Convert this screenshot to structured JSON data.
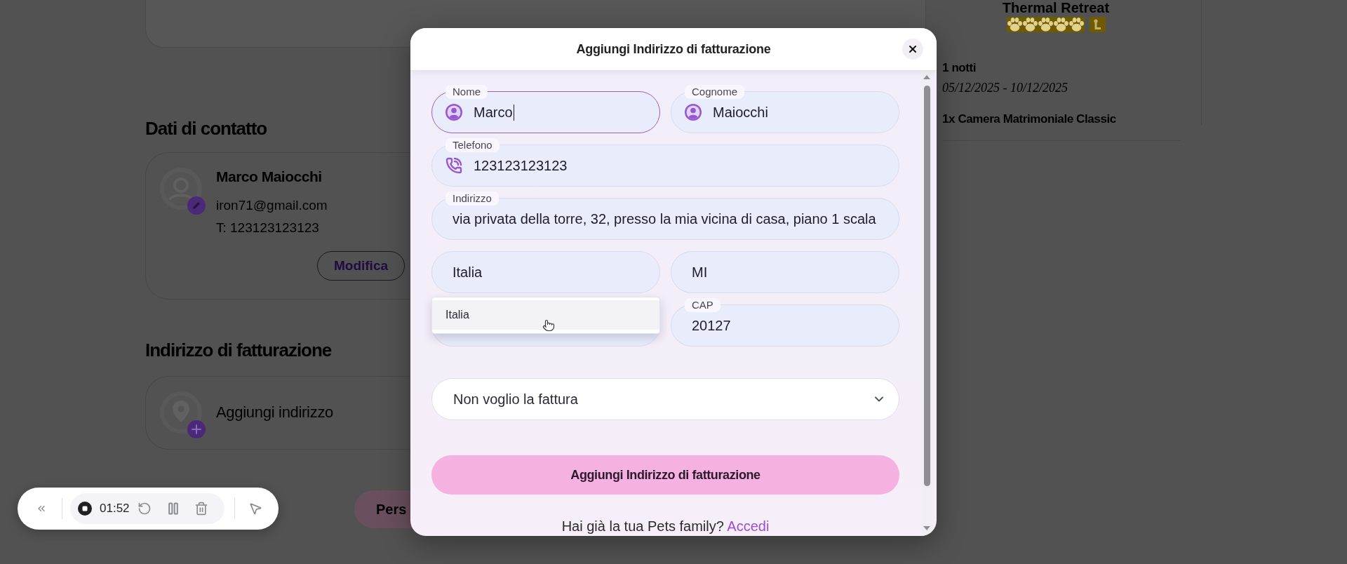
{
  "page": {
    "summary": {
      "title": "Thermal Retreat",
      "stars": 5,
      "nights": "1 notti",
      "dates": "05/12/2025 - 10/12/2025",
      "room": "1x Camera Matrimoniale Classic"
    },
    "contact": {
      "heading": "Dati di contatto",
      "name": "Marco Maiocchi",
      "email": "iron71@gmail.com",
      "phone": "T: 123123123123",
      "edit_button": "Modifica"
    },
    "billing": {
      "heading": "Indirizzo di fatturazione",
      "add_label": "Aggiungi indirizzo"
    },
    "proceed_button": "Pers"
  },
  "recorder": {
    "time": "01:52"
  },
  "modal": {
    "title": "Aggiungi Indirizzo di fatturazione",
    "rows": [
      [
        {
          "kind": "person",
          "label": "Nome",
          "value": "Marco",
          "focused": true
        },
        {
          "kind": "person",
          "label": "Cognome",
          "value": "Maiocchi",
          "focused": false
        }
      ],
      [
        {
          "kind": "phone",
          "label": "Telefono",
          "value": "123123123123",
          "focused": false
        }
      ],
      [
        {
          "kind": "plain",
          "label": "Indirizzo",
          "value": "via privata della torre, 32, presso la mia vicina di casa, piano 1 scala",
          "focused": false
        }
      ],
      [
        {
          "kind": "plain",
          "value": "Italia",
          "focused": false,
          "suggestions": [
            "Italia"
          ]
        },
        {
          "kind": "plain",
          "value": "MI",
          "focused": false
        }
      ],
      [
        {
          "kind": "plain",
          "focused": false
        },
        {
          "kind": "plain",
          "label": "CAP",
          "value": "20127",
          "focused": false
        }
      ]
    ],
    "invoice_select": {
      "value": "Non voglio la fattura"
    },
    "submit_button": "Aggiungi Indirizzo di fatturazione",
    "footer": {
      "text": "Hai già la tua Pets family?",
      "link": "Accedi"
    }
  }
}
